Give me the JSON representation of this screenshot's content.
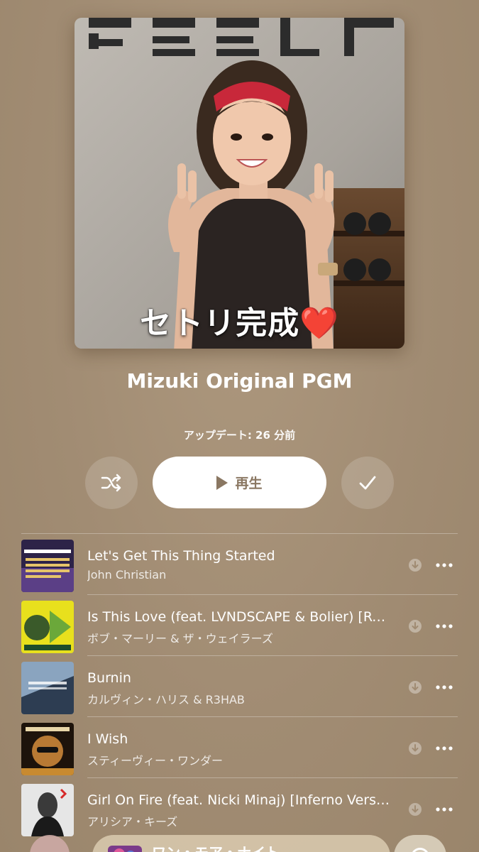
{
  "artwork": {
    "caption": "セトリ完成",
    "caption_heart": "❤️",
    "wall_sign": "FEELC"
  },
  "playlist": {
    "title": "Mizuki Original PGM",
    "updated": "アップデート: 26 分前"
  },
  "actions": {
    "shuffle_icon": "shuffle-icon",
    "play_label": "再生",
    "check_icon": "checkmark-icon"
  },
  "tracks": [
    {
      "title": "Let's Get This Thing Started",
      "artist": "John Christian",
      "thumb_color": "#3a2a5e"
    },
    {
      "title": "Is This Love (feat. LVNDSCAPE & Bolier) [Re...",
      "artist": "ボブ・マーリー & ザ・ウェイラーズ",
      "thumb_color": "#e8e31b"
    },
    {
      "title": "Burnin",
      "artist": "カルヴィン・ハリス & R3HAB",
      "thumb_color": "#6b8aa8"
    },
    {
      "title": "I Wish",
      "artist": "スティーヴィー・ワンダー",
      "thumb_color": "#c98a2a"
    },
    {
      "title": "Girl On Fire (feat. Nicki Minaj) [Inferno Versi...",
      "artist": "アリシア・キーズ",
      "thumb_color": "#d9d9d9"
    }
  ],
  "mini_player": {
    "title": "ワン・モア・ナイト"
  },
  "colors": {
    "background": "#a08b72",
    "accent_text": "#8a7762",
    "white": "#ffffff"
  }
}
